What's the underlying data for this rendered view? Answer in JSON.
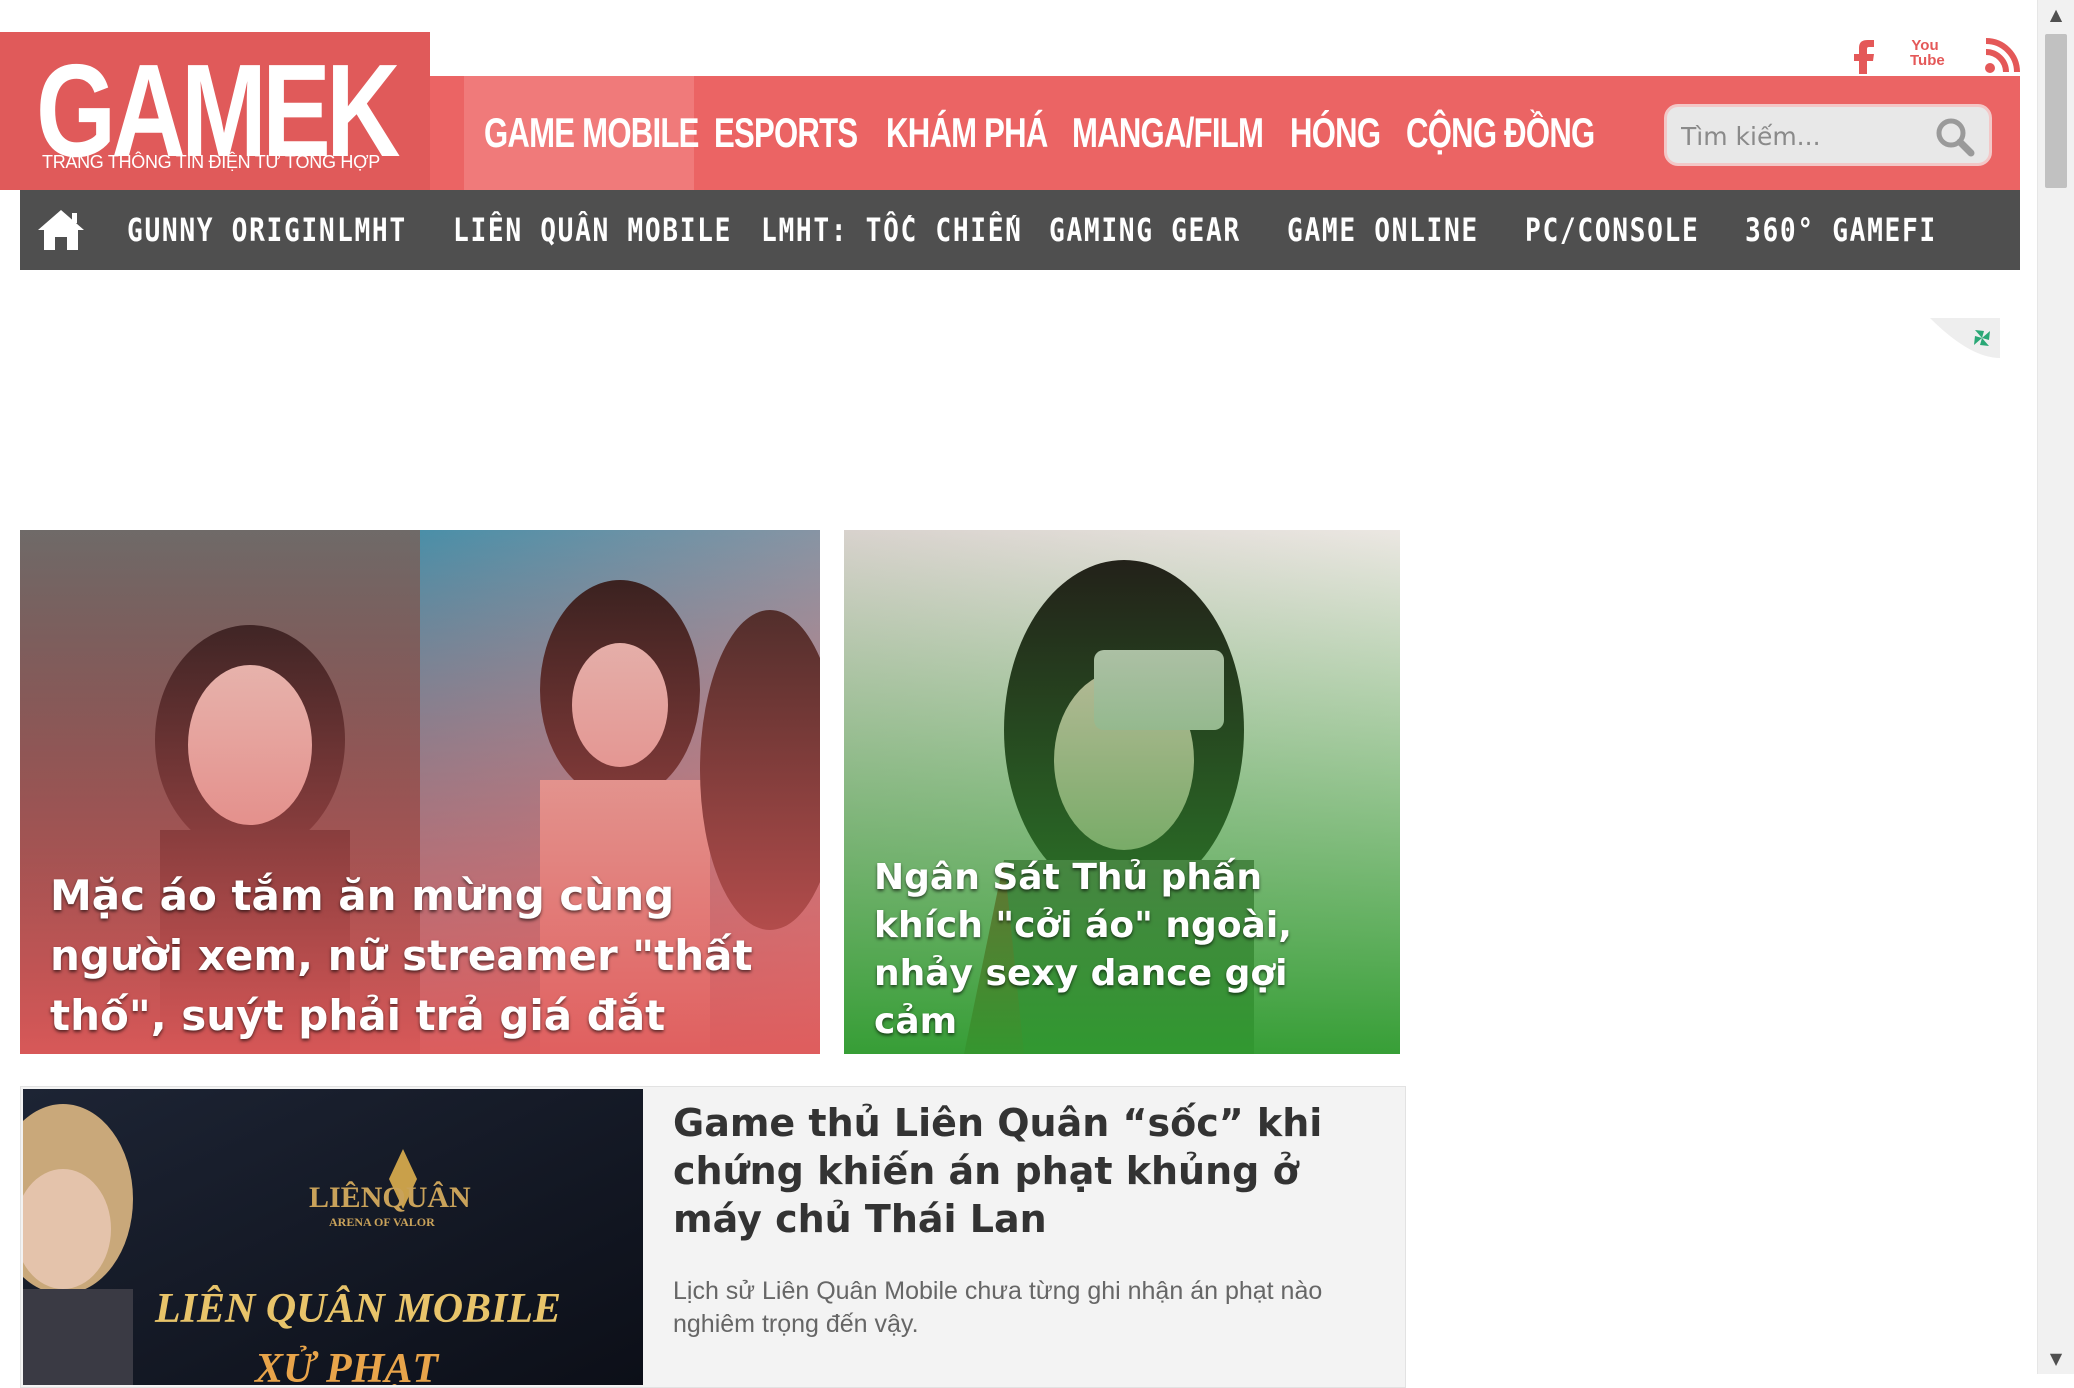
{
  "site": {
    "logo": "GAMEK",
    "tagline": "TRANG THÔNG TIN ĐIỆN TỬ TỔNG HỢP"
  },
  "social": {
    "youtube_text": "You Tube"
  },
  "main_nav": [
    {
      "label": "GAME MOBILE",
      "active": true
    },
    {
      "label": "ESPORTS",
      "active": false
    },
    {
      "label": "KHÁM PHÁ",
      "active": false
    },
    {
      "label": "MANGA/FILM",
      "active": false
    },
    {
      "label": "HÓNG",
      "active": false
    },
    {
      "label": "CỘNG ĐỒNG",
      "active": false
    }
  ],
  "search": {
    "placeholder": "Tìm kiếm...",
    "icon": "search-icon"
  },
  "sub_nav": [
    "GUNNY ORIGIN",
    "LMHT",
    "LIÊN QUÂN MOBILE",
    "LMHT: TỐC CHIẾN",
    "GAMING GEAR",
    "GAME ONLINE",
    "PC/CONSOLE",
    "360° GAMEFI"
  ],
  "featured": [
    {
      "title": "Mặc áo tắm ăn mừng cùng người xem, nữ streamer \"thất thố\", suýt phải trả giá đắt"
    },
    {
      "title": "Ngân Sát Thủ phấn khích \"cởi áo\" ngoài, nhảy sexy dance gợi cảm"
    }
  ],
  "article": {
    "headline": "Game thủ Liên Quân “sốc” khi chứng khiến án phạt khủng ở máy chủ Thái Lan",
    "excerpt": "Lịch sử Liên Quân Mobile chưa từng ghi nhận án phạt nào nghiêm trọng đến vậy.",
    "thumb_logo": "LIÊNQUÂN",
    "thumb_logo_sub": "ARENA OF VALOR",
    "thumb_caption_1": "LIÊN QUÂN MOBILE",
    "thumb_caption_2": "XỬ PHẠT"
  },
  "colors": {
    "brand_red": "#e05a5a",
    "nav_red": "#eb6464",
    "subnav_gray": "#4f4f4f"
  }
}
